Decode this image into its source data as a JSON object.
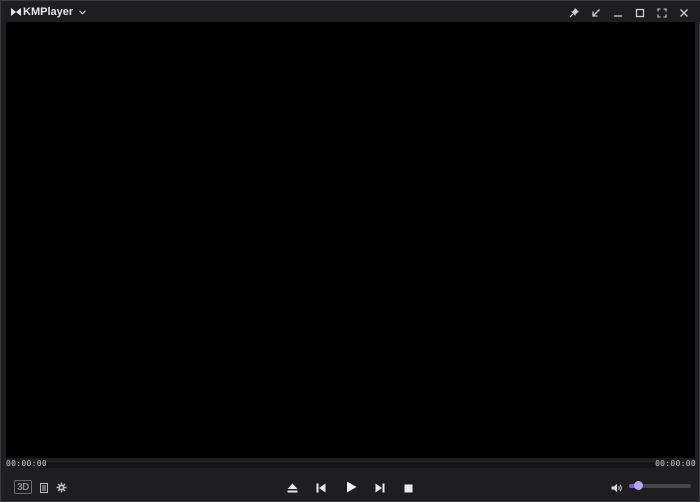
{
  "app": {
    "title": "KMPlayer"
  },
  "titlebar": {
    "buttons": [
      "pin",
      "minimize-to-corner",
      "minimize",
      "maximize",
      "fullscreen",
      "close"
    ]
  },
  "playback": {
    "current_time": "00:00:00",
    "total_time": "00:00:00",
    "progress": 0
  },
  "controls": {
    "left": {
      "badge_3d": "3D",
      "icons": [
        "playlist-icon",
        "settings-icon"
      ]
    },
    "center": [
      "eject-icon",
      "previous-icon",
      "play-icon",
      "next-icon",
      "stop-icon"
    ],
    "volume": {
      "icon": "volume-icon",
      "level": 0.14
    }
  },
  "colors": {
    "background": "#1e1e21",
    "video": "#000000",
    "accent": "#7b5bd6"
  }
}
